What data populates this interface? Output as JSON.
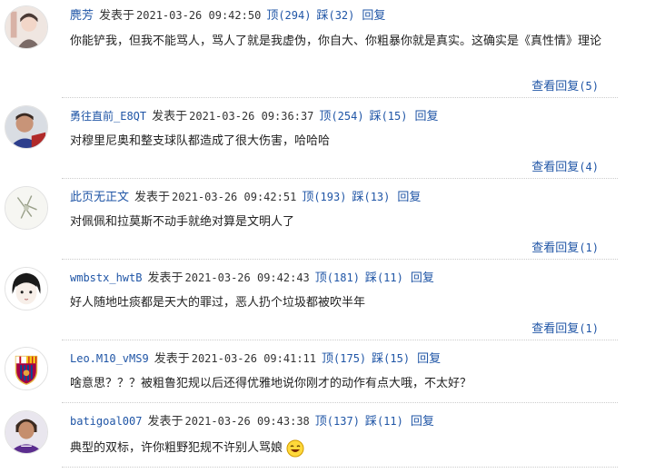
{
  "labels": {
    "posted_at": "发表于",
    "upvote": "顶",
    "downvote": "踩",
    "reply": "回复",
    "view_replies": "查看回复"
  },
  "comments": [
    {
      "username": "麂芳",
      "timestamp": "2021-03-26 09:42:50",
      "upvotes": "(294)",
      "downvotes": "(32)",
      "text": "你能铲我，但我不能骂人，骂人了就是我虚伪，你自大、你粗暴你就是真实。这确实是《真性情》理论",
      "replies": "(5)"
    },
    {
      "username": "勇往直前_E8QT",
      "timestamp": "2021-03-26 09:36:37",
      "upvotes": "(254)",
      "downvotes": "(15)",
      "text": "对穆里尼奥和整支球队都造成了很大伤害，哈哈哈",
      "replies": "(4)"
    },
    {
      "username": "此页无正文",
      "timestamp": "2021-03-26 09:42:51",
      "upvotes": "(193)",
      "downvotes": "(13)",
      "text": "对佩佩和拉莫斯不动手就绝对算是文明人了",
      "replies": "(1)"
    },
    {
      "username": "wmbstx_hwtB",
      "timestamp": "2021-03-26 09:42:43",
      "upvotes": "(181)",
      "downvotes": "(11)",
      "text": "好人随地吐痰都是天大的罪过，恶人扔个垃圾都被吹半年",
      "replies": "(1)"
    },
    {
      "username": "Leo.M10_vMS9",
      "timestamp": "2021-03-26 09:41:11",
      "upvotes": "(175)",
      "downvotes": "(15)",
      "text": "啥意思？？？被粗鲁犯规以后还得优雅地说你刚才的动作有点大哦，不太好？"
    },
    {
      "username": "batigoal007",
      "timestamp": "2021-03-26 09:43:38",
      "upvotes": "(137)",
      "downvotes": "(11)",
      "text": "典型的双标，许你粗野犯规不许别人骂娘"
    }
  ],
  "icons": {
    "avatar_1": "portrait-avatar-icon",
    "avatar_2": "footballer-avatar-icon",
    "avatar_3": "sketch-avatar-icon",
    "avatar_4": "anime-face-avatar-icon",
    "avatar_5": "barcelona-crest-avatar-icon",
    "avatar_6": "fiorentina-player-avatar-icon",
    "emoji": "laughing-face-emoji-icon"
  },
  "colors": {
    "link": "#1f55a6",
    "text": "#222222",
    "divider": "#cccccc"
  }
}
